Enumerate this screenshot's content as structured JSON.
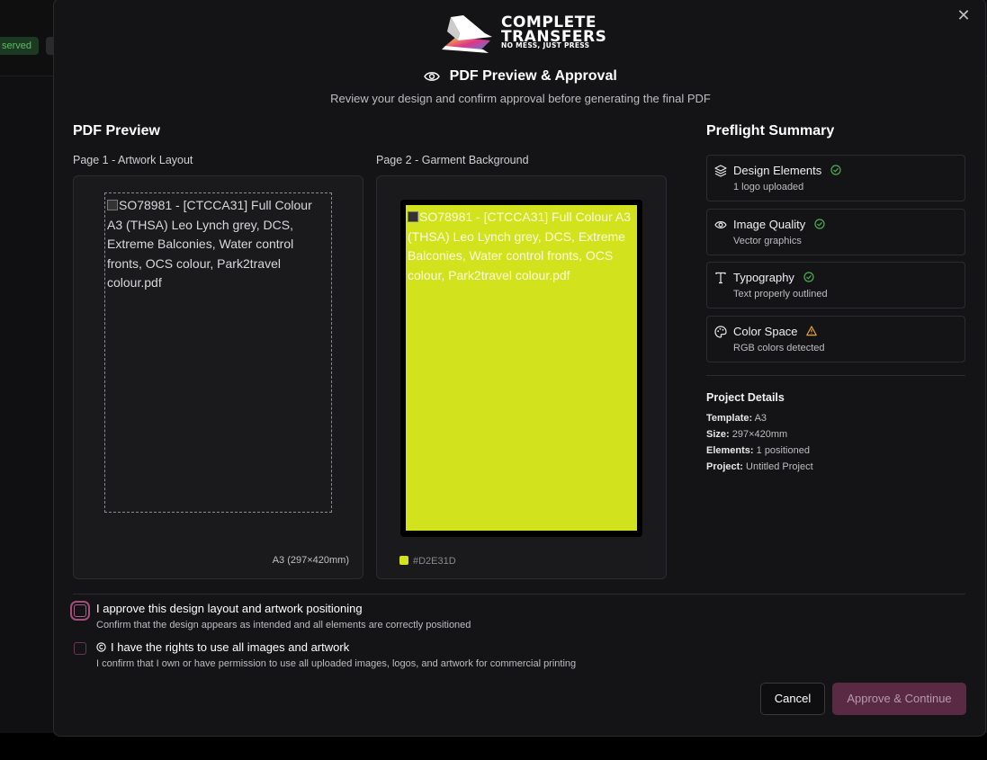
{
  "background": {
    "badge_label": "served"
  },
  "modal": {
    "close_glyph": "✕",
    "logo": {
      "title_line1": "COMPLETE",
      "title_line2": "TRANSFERS",
      "tagline": "NO MESS, JUST PRESS"
    },
    "title": "PDF Preview & Approval",
    "subtitle": "Review your design and confirm approval before generating the final PDF"
  },
  "preview": {
    "heading": "PDF Preview",
    "page1": {
      "label": "Page 1 - Artwork Layout",
      "image_alt": "SO78981 - [CTCCA31] Full Colour A3 (THSA) Leo Lynch grey, DCS, Extreme Balconies, Water control fronts, OCS colour, Park2travel colour.pdf",
      "size_label": "A3 (297×420mm)"
    },
    "page2": {
      "label": "Page 2 - Garment Background",
      "image_alt": "SO78981 - [CTCCA31] Full Colour A3 (THSA) Leo Lynch grey, DCS, Extreme Balconies, Water control fronts, OCS colour, Park2travel colour.pdf",
      "garment_color": "#D2E31D",
      "color_label": "#D2E31D"
    }
  },
  "preflight": {
    "heading": "Preflight Summary",
    "items": [
      {
        "title": "Design Elements",
        "desc": "1 logo uploaded",
        "icon": "layers-icon",
        "status": "ok"
      },
      {
        "title": "Image Quality",
        "desc": "Vector graphics",
        "icon": "eye-icon",
        "status": "ok"
      },
      {
        "title": "Typography",
        "desc": "Text properly outlined",
        "icon": "type-icon",
        "status": "ok"
      },
      {
        "title": "Color Space",
        "desc": "RGB colors detected",
        "icon": "palette-icon",
        "status": "warning"
      }
    ],
    "status_colors": {
      "ok": "#4caf50",
      "warning": "#e8a33c"
    }
  },
  "project": {
    "heading": "Project Details",
    "template_label": "Template:",
    "template_value": "A3",
    "size_label": "Size:",
    "size_value": "297×420mm",
    "elements_label": "Elements:",
    "elements_value": "1 positioned",
    "project_label": "Project:",
    "project_value": "Untitled Project"
  },
  "approvals": {
    "design": {
      "title": "I approve this design layout and artwork positioning",
      "desc": "Confirm that the design appears as intended and all elements are correctly positioned"
    },
    "rights": {
      "title": "I have the rights to use all images and artwork",
      "desc": "I confirm that I own or have permission to use all uploaded images, logos, and artwork for commercial printing"
    }
  },
  "buttons": {
    "cancel": "Cancel",
    "approve": "Approve & Continue"
  }
}
